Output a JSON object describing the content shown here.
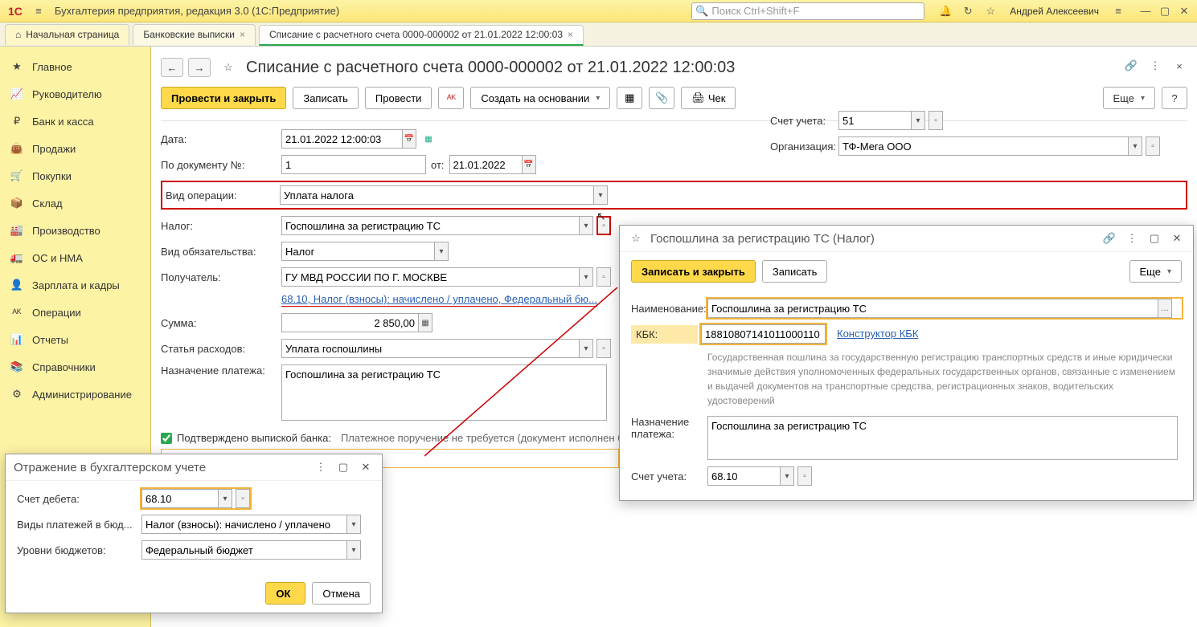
{
  "app": {
    "title": "Бухгалтерия предприятия, редакция 3.0  (1С:Предприятие)",
    "search_placeholder": "Поиск Ctrl+Shift+F",
    "user": "Андрей Алексеевич"
  },
  "tabs": {
    "home": "Начальная страница",
    "t1": "Банковские выписки",
    "t2": "Списание с расчетного счета 0000-000002 от 21.01.2022 12:00:03"
  },
  "sidebar": [
    "Главное",
    "Руководителю",
    "Банк и касса",
    "Продажи",
    "Покупки",
    "Склад",
    "Производство",
    "ОС и НМА",
    "Зарплата и кадры",
    "Операции",
    "Отчеты",
    "Справочники",
    "Администрирование"
  ],
  "sidebar_icons": [
    "★",
    "📈",
    "₽",
    "👜",
    "🛒",
    "📦",
    "🏭",
    "🚛",
    "👤",
    "ᴬᴷ",
    "📊",
    "📚",
    "⚙"
  ],
  "doc": {
    "title": "Списание с расчетного счета 0000-000002 от 21.01.2022 12:00:03",
    "btn_post_close": "Провести и закрыть",
    "btn_write": "Записать",
    "btn_post": "Провести",
    "btn_create_based": "Создать на основании",
    "btn_check": "Чек",
    "btn_more": "Еще",
    "labels": {
      "date": "Дата:",
      "docnum": "По документу №:",
      "from": "от:",
      "optype": "Вид операции:",
      "tax": "Налог:",
      "obligation": "Вид обязательства:",
      "recipient": "Получатель:",
      "sum": "Сумма:",
      "expense": "Статья расходов:",
      "purpose": "Назначение платежа:",
      "account": "Счет учета:",
      "org": "Организация:"
    },
    "values": {
      "date": "21.01.2022 12:00:03",
      "docnum": "1",
      "docdate": "21.01.2022",
      "optype": "Уплата налога",
      "tax": "Госпошлина за регистрацию ТС",
      "obligation": "Налог",
      "recipient": "ГУ МВД РОССИИ ПО Г. МОСКВЕ",
      "link": "68.10, Налог (взносы): начислено / уплачено, Федеральный бю...",
      "sum": "2 850,00",
      "expense": "Уплата госпошлины",
      "purpose": "Госпошлина за регистрацию ТС",
      "account": "51",
      "org": "ТФ-Мега ООО"
    },
    "confirm_label": "Подтверждено выпиской банка:",
    "confirm_text": "Платежное поручение не требуется (документ исполнен б"
  },
  "acct_panel": {
    "title": "Отражение в бухгалтерском учете",
    "labels": {
      "debit": "Счет дебета:",
      "ptype": "Виды платежей в бюд...",
      "blevel": "Уровни бюджетов:"
    },
    "values": {
      "debit": "68.10",
      "ptype": "Налог (взносы): начислено / уплачено",
      "blevel": "Федеральный бюджет"
    },
    "ok": "ОК",
    "cancel": "Отмена"
  },
  "tax_panel": {
    "title": "Госпошлина за регистрацию ТС (Налог)",
    "btn_write_close": "Записать и закрыть",
    "btn_write": "Записать",
    "btn_more": "Еще",
    "labels": {
      "name": "Наименование:",
      "kbk": "КБК:",
      "purpose": "Назначение платежа:",
      "account": "Счет учета:"
    },
    "values": {
      "name": "Госпошлина за регистрацию ТС",
      "kbk": "18810807141011000110",
      "account": "68.10",
      "purpose": "Госпошлина за регистрацию ТС"
    },
    "kbk_link": "Конструктор КБК",
    "desc": "Государственная пошлина за государственную регистрацию транспортных средств и иные юридически значимые действия уполномоченных федеральных государственных органов, связанные с изменением и выдачей документов на транспортные средства, регистрационных знаков, водительских удостоверений"
  }
}
